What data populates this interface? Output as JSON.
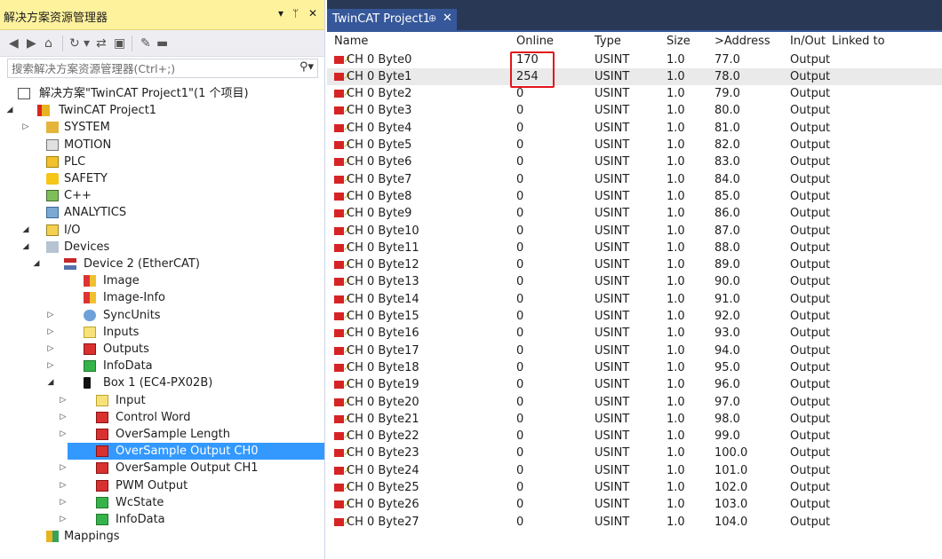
{
  "solution_explorer": {
    "title": "解决方案资源管理器",
    "title_buttons": {
      "dropdown": "▾",
      "pin": "ᛘ",
      "close": "✕"
    },
    "search_placeholder": "搜索解决方案资源管理器(Ctrl+;)",
    "tree": [
      {
        "label": "解决方案\"TwinCAT Project1\"(1 个项目)",
        "indent": 0,
        "arrow": "",
        "icon": "solution-icon",
        "icon_class": "ic-sol"
      },
      {
        "label": "TwinCAT Project1",
        "indent": 1,
        "arrow": "◢",
        "icon": "twincat-project-icon",
        "icon_class": "ic-proj"
      },
      {
        "label": "SYSTEM",
        "indent": 2,
        "arrow": "▷",
        "icon": "system-icon",
        "icon_class": "ic-system"
      },
      {
        "label": "MOTION",
        "indent": 2,
        "arrow": "",
        "icon": "motion-icon",
        "icon_class": "ic-motion"
      },
      {
        "label": "PLC",
        "indent": 2,
        "arrow": "",
        "icon": "plc-icon",
        "icon_class": "ic-plc"
      },
      {
        "label": "SAFETY",
        "indent": 2,
        "arrow": "",
        "icon": "safety-icon",
        "icon_class": "ic-safety"
      },
      {
        "label": "C++",
        "indent": 2,
        "arrow": "",
        "icon": "cpp-icon",
        "icon_class": "ic-cpp"
      },
      {
        "label": "ANALYTICS",
        "indent": 2,
        "arrow": "",
        "icon": "analytics-icon",
        "icon_class": "ic-analytics"
      },
      {
        "label": "I/O",
        "indent": 2,
        "arrow": "◢",
        "icon": "io-icon",
        "icon_class": "ic-io"
      },
      {
        "label": "Devices",
        "indent": 3,
        "arrow": "◢",
        "icon": "devices-icon",
        "icon_class": "ic-devices"
      },
      {
        "label": "Device 2 (EtherCAT)",
        "indent": 4,
        "arrow": "◢",
        "icon": "ethercat-device-icon",
        "icon_class": "ic-device"
      },
      {
        "label": "Image",
        "indent": 5,
        "arrow": "",
        "icon": "image-icon",
        "icon_class": "ic-image"
      },
      {
        "label": "Image-Info",
        "indent": 5,
        "arrow": "",
        "icon": "image-info-icon",
        "icon_class": "ic-image"
      },
      {
        "label": "SyncUnits",
        "indent": 5,
        "arrow": "▷",
        "icon": "syncunits-icon",
        "icon_class": "ic-sync"
      },
      {
        "label": "Inputs",
        "indent": 5,
        "arrow": "▷",
        "icon": "inputs-icon",
        "icon_class": "ic-inputs"
      },
      {
        "label": "Outputs",
        "indent": 5,
        "arrow": "▷",
        "icon": "outputs-icon",
        "icon_class": "ic-outputs"
      },
      {
        "label": "InfoData",
        "indent": 5,
        "arrow": "▷",
        "icon": "infodata-icon",
        "icon_class": "ic-info"
      },
      {
        "label": "Box 1 (EC4-PX02B)",
        "indent": 5,
        "arrow": "◢",
        "icon": "box-icon",
        "icon_class": "ic-box"
      },
      {
        "label": "Input",
        "indent": 6,
        "arrow": "▷",
        "icon": "input-icon",
        "icon_class": "ic-inputs"
      },
      {
        "label": "Control Word",
        "indent": 6,
        "arrow": "▷",
        "icon": "control-word-icon",
        "icon_class": "ic-outputs"
      },
      {
        "label": "OverSample Length",
        "indent": 6,
        "arrow": "▷",
        "icon": "oversample-length-icon",
        "icon_class": "ic-outputs"
      },
      {
        "label": "OverSample Output CH0",
        "indent": 6,
        "arrow": "▷",
        "icon": "oversample-output-ch0-icon",
        "icon_class": "ic-outputs",
        "selected": true
      },
      {
        "label": "OverSample Output CH1",
        "indent": 6,
        "arrow": "▷",
        "icon": "oversample-output-ch1-icon",
        "icon_class": "ic-outputs"
      },
      {
        "label": "PWM Output",
        "indent": 6,
        "arrow": "▷",
        "icon": "pwm-output-icon",
        "icon_class": "ic-outputs"
      },
      {
        "label": "WcState",
        "indent": 6,
        "arrow": "▷",
        "icon": "wcstate-icon",
        "icon_class": "ic-info"
      },
      {
        "label": "InfoData",
        "indent": 6,
        "arrow": "▷",
        "icon": "infodata-icon",
        "icon_class": "ic-info"
      },
      {
        "label": "Mappings",
        "indent": 3,
        "arrow": "",
        "icon": "mappings-icon",
        "icon_class": "ic-mappings"
      }
    ]
  },
  "document": {
    "tab_label": "TwinCAT Project1",
    "tab_pin": "⊕",
    "tab_close": "✕",
    "columns": [
      "Name",
      "Online",
      "Type",
      "Size",
      ">Address",
      "In/Out",
      "Linked to"
    ],
    "rows": [
      {
        "name": "CH 0 Byte0",
        "online": "170",
        "type": "USINT",
        "size": "1.0",
        "address": "77.0",
        "inout": "Output",
        "linked": ""
      },
      {
        "name": "CH 0 Byte1",
        "online": "254",
        "type": "USINT",
        "size": "1.0",
        "address": "78.0",
        "inout": "Output",
        "linked": ""
      },
      {
        "name": "CH 0 Byte2",
        "online": "0",
        "type": "USINT",
        "size": "1.0",
        "address": "79.0",
        "inout": "Output",
        "linked": ""
      },
      {
        "name": "CH 0 Byte3",
        "online": "0",
        "type": "USINT",
        "size": "1.0",
        "address": "80.0",
        "inout": "Output",
        "linked": ""
      },
      {
        "name": "CH 0 Byte4",
        "online": "0",
        "type": "USINT",
        "size": "1.0",
        "address": "81.0",
        "inout": "Output",
        "linked": ""
      },
      {
        "name": "CH 0 Byte5",
        "online": "0",
        "type": "USINT",
        "size": "1.0",
        "address": "82.0",
        "inout": "Output",
        "linked": ""
      },
      {
        "name": "CH 0 Byte6",
        "online": "0",
        "type": "USINT",
        "size": "1.0",
        "address": "83.0",
        "inout": "Output",
        "linked": ""
      },
      {
        "name": "CH 0 Byte7",
        "online": "0",
        "type": "USINT",
        "size": "1.0",
        "address": "84.0",
        "inout": "Output",
        "linked": ""
      },
      {
        "name": "CH 0 Byte8",
        "online": "0",
        "type": "USINT",
        "size": "1.0",
        "address": "85.0",
        "inout": "Output",
        "linked": ""
      },
      {
        "name": "CH 0 Byte9",
        "online": "0",
        "type": "USINT",
        "size": "1.0",
        "address": "86.0",
        "inout": "Output",
        "linked": ""
      },
      {
        "name": "CH 0 Byte10",
        "online": "0",
        "type": "USINT",
        "size": "1.0",
        "address": "87.0",
        "inout": "Output",
        "linked": ""
      },
      {
        "name": "CH 0 Byte11",
        "online": "0",
        "type": "USINT",
        "size": "1.0",
        "address": "88.0",
        "inout": "Output",
        "linked": ""
      },
      {
        "name": "CH 0 Byte12",
        "online": "0",
        "type": "USINT",
        "size": "1.0",
        "address": "89.0",
        "inout": "Output",
        "linked": ""
      },
      {
        "name": "CH 0 Byte13",
        "online": "0",
        "type": "USINT",
        "size": "1.0",
        "address": "90.0",
        "inout": "Output",
        "linked": ""
      },
      {
        "name": "CH 0 Byte14",
        "online": "0",
        "type": "USINT",
        "size": "1.0",
        "address": "91.0",
        "inout": "Output",
        "linked": ""
      },
      {
        "name": "CH 0 Byte15",
        "online": "0",
        "type": "USINT",
        "size": "1.0",
        "address": "92.0",
        "inout": "Output",
        "linked": ""
      },
      {
        "name": "CH 0 Byte16",
        "online": "0",
        "type": "USINT",
        "size": "1.0",
        "address": "93.0",
        "inout": "Output",
        "linked": ""
      },
      {
        "name": "CH 0 Byte17",
        "online": "0",
        "type": "USINT",
        "size": "1.0",
        "address": "94.0",
        "inout": "Output",
        "linked": ""
      },
      {
        "name": "CH 0 Byte18",
        "online": "0",
        "type": "USINT",
        "size": "1.0",
        "address": "95.0",
        "inout": "Output",
        "linked": ""
      },
      {
        "name": "CH 0 Byte19",
        "online": "0",
        "type": "USINT",
        "size": "1.0",
        "address": "96.0",
        "inout": "Output",
        "linked": ""
      },
      {
        "name": "CH 0 Byte20",
        "online": "0",
        "type": "USINT",
        "size": "1.0",
        "address": "97.0",
        "inout": "Output",
        "linked": ""
      },
      {
        "name": "CH 0 Byte21",
        "online": "0",
        "type": "USINT",
        "size": "1.0",
        "address": "98.0",
        "inout": "Output",
        "linked": ""
      },
      {
        "name": "CH 0 Byte22",
        "online": "0",
        "type": "USINT",
        "size": "1.0",
        "address": "99.0",
        "inout": "Output",
        "linked": ""
      },
      {
        "name": "CH 0 Byte23",
        "online": "0",
        "type": "USINT",
        "size": "1.0",
        "address": "100.0",
        "inout": "Output",
        "linked": ""
      },
      {
        "name": "CH 0 Byte24",
        "online": "0",
        "type": "USINT",
        "size": "1.0",
        "address": "101.0",
        "inout": "Output",
        "linked": ""
      },
      {
        "name": "CH 0 Byte25",
        "online": "0",
        "type": "USINT",
        "size": "1.0",
        "address": "102.0",
        "inout": "Output",
        "linked": ""
      },
      {
        "name": "CH 0 Byte26",
        "online": "0",
        "type": "USINT",
        "size": "1.0",
        "address": "103.0",
        "inout": "Output",
        "linked": ""
      },
      {
        "name": "CH 0 Byte27",
        "online": "0",
        "type": "USINT",
        "size": "1.0",
        "address": "104.0",
        "inout": "Output",
        "linked": ""
      }
    ]
  },
  "colors": {
    "explorer_title_bg": "#fff29d",
    "tab_strip_bg": "#293955",
    "active_tab_bg": "#36589a",
    "selection_bg": "#3399ff",
    "annotation_red": "#e3141c",
    "output_var_red": "#d62424"
  }
}
